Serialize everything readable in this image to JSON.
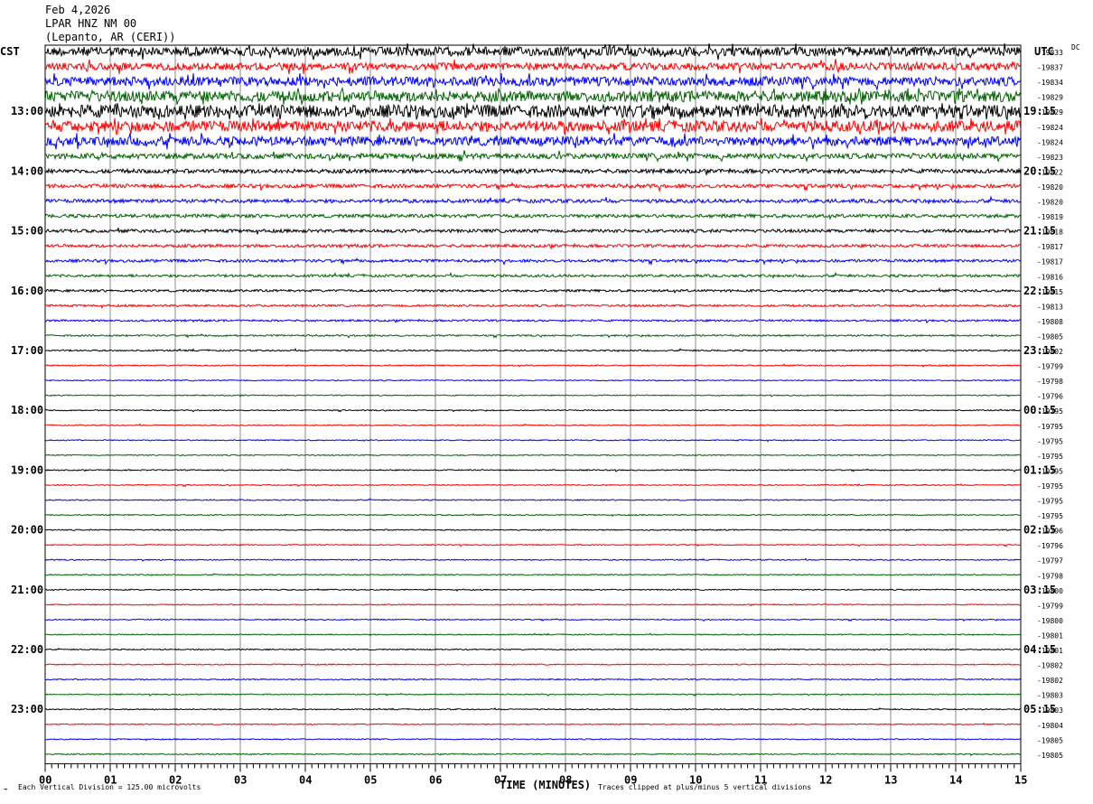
{
  "header": {
    "date": "Feb 4,2026",
    "station": "LPAR HNZ NM 00",
    "location": "(Lepanto, AR (CERI))"
  },
  "chart_data": {
    "type": "line",
    "subtype": "helicorder",
    "left_zone": "CST",
    "right_zone": "UTC",
    "dc_label": "DC",
    "xlabel": "TIME (MINUTES)",
    "xlim": [
      0,
      15
    ],
    "x_ticks": [
      "00",
      "01",
      "02",
      "03",
      "04",
      "05",
      "06",
      "07",
      "08",
      "09",
      "10",
      "11",
      "12",
      "13",
      "14",
      "15"
    ],
    "left_time_labels": [
      "13:00",
      "14:00",
      "15:00",
      "16:00",
      "17:00",
      "18:00",
      "19:00",
      "20:00",
      "21:00",
      "22:00",
      "23:00"
    ],
    "right_time_labels": [
      "19:15",
      "20:15",
      "21:15",
      "22:15",
      "23:15",
      "00:15",
      "01:15",
      "02:15",
      "03:15",
      "04:15",
      "05:15"
    ],
    "trace_colors": [
      "#000000",
      "#ff0000",
      "#0000ff",
      "#006400"
    ],
    "dc_offsets": [
      -19833,
      -19837,
      -19834,
      -19829,
      -19829,
      -19824,
      -19824,
      -19823,
      -19822,
      -19820,
      -19820,
      -19819,
      -19818,
      -19817,
      -19817,
      -19816,
      -19815,
      -19813,
      -19808,
      -19805,
      -19802,
      -19799,
      -19798,
      -19796,
      -19795,
      -19795,
      -19795,
      -19795,
      -19795,
      -19795,
      -19795,
      -19795,
      -19796,
      -19796,
      -19797,
      -19798,
      -19800,
      -19799,
      -19800,
      -19801,
      -19801,
      -19802,
      -19802,
      -19803,
      -19803,
      -19804,
      -19805,
      -19805
    ],
    "scale_note": "Each Vertical Division =  125.00 microvolts",
    "clip_note": "Traces clipped at plus/minus 5 vertical divisions"
  }
}
